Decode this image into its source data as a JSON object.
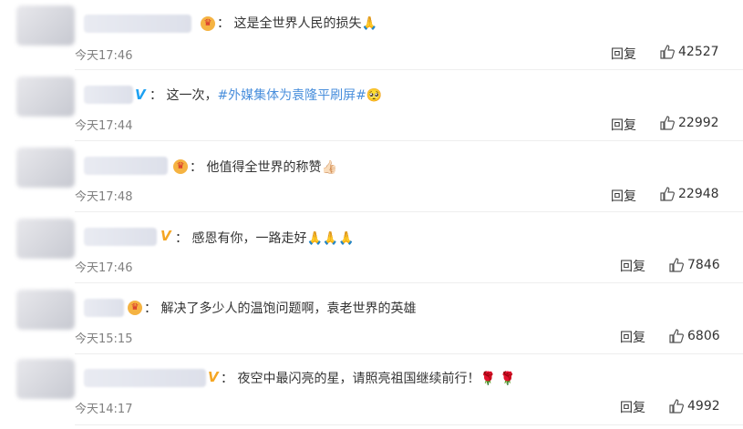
{
  "comments": [
    {
      "text": "这是全世界人民的损失🙏",
      "time": "今天17:46",
      "reply": "回复",
      "likes": "42527",
      "badge": "crown"
    },
    {
      "text_prefix": "这一次，",
      "topic": "#外媒集体为袁隆平刷屏#",
      "emoji": "🥺",
      "time": "今天17:44",
      "reply": "回复",
      "likes": "22992",
      "badge": "v"
    },
    {
      "text": "他值得全世界的称赞👍🏻",
      "time": "今天17:48",
      "reply": "回复",
      "likes": "22948",
      "badge": "crown"
    },
    {
      "text": "感恩有你，一路走好🙏🙏🙏",
      "time": "今天17:46",
      "reply": "回复",
      "likes": "7846",
      "badge": "vgold"
    },
    {
      "text": "解决了多少人的温饱问题啊，袁老世界的英雄",
      "time": "今天15:15",
      "reply": "回复",
      "likes": "6806",
      "badge": "crown"
    },
    {
      "text": "夜空中最闪亮的星，请照亮祖国继续前行！🌹 🌹",
      "time": "今天14:17",
      "reply": "回复",
      "likes": "4992",
      "badge": "vgold"
    }
  ],
  "colon": "："
}
